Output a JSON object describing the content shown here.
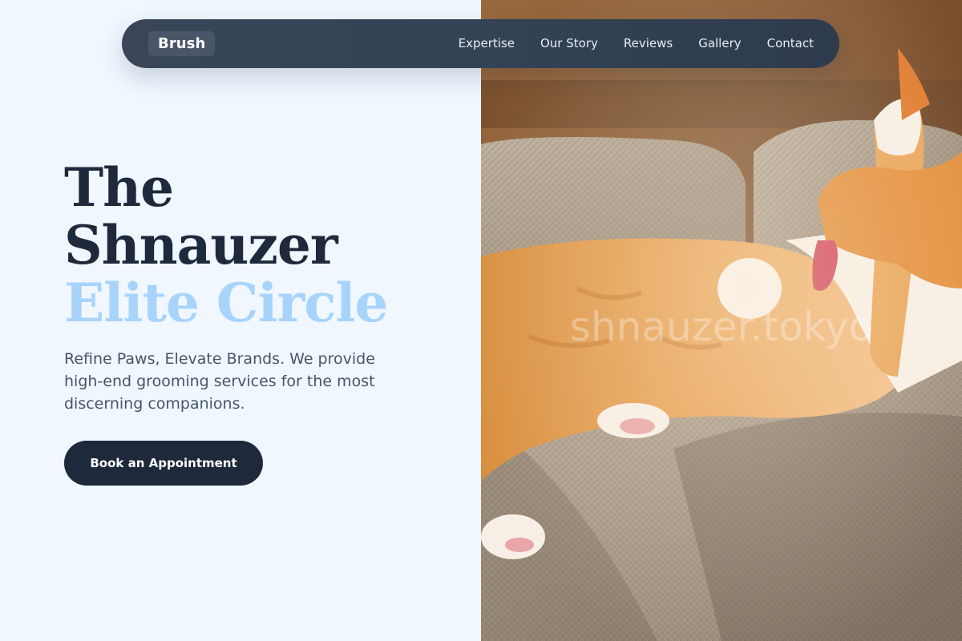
{
  "brand": {
    "name": "Brush"
  },
  "nav": {
    "items": [
      {
        "label": "Expertise"
      },
      {
        "label": "Our Story"
      },
      {
        "label": "Reviews"
      },
      {
        "label": "Gallery"
      },
      {
        "label": "Contact"
      }
    ]
  },
  "hero": {
    "title_line1": "The",
    "title_line2": "Shnauzer",
    "title_accent": "Elite Circle",
    "description": "Refine Paws, Elevate Brands. We provide high-end grooming services for the most discerning companions.",
    "cta_label": "Book an Appointment"
  },
  "photo": {
    "subject": "orange-and-white cat lying on a woven couch, licking its raised paw",
    "watermark": "shnauzer.tokyo"
  },
  "colors": {
    "page_bg": "#f0f7ff",
    "nav_bg": "#334155",
    "heading": "#1e293b",
    "accent": "#a8d4fc",
    "body_text": "#475569",
    "cta_bg": "#1e293b"
  }
}
